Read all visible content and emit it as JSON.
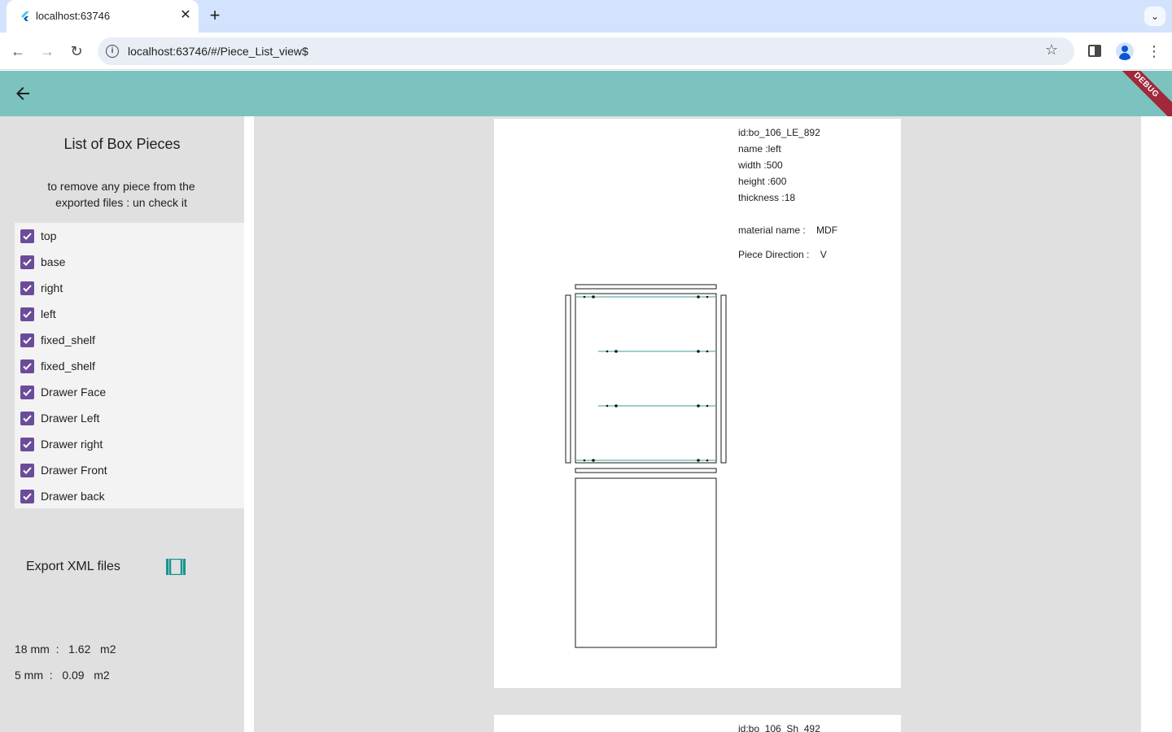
{
  "browser": {
    "tab_title": "localhost:63746",
    "url": "localhost:63746/#/Piece_List_view$"
  },
  "appbar": {
    "debug_label": "DEBUG"
  },
  "sidebar": {
    "title": "List of Box Pieces",
    "hint": "to remove any piece from the exported files : un check it",
    "pieces": [
      {
        "label": "top",
        "checked": true
      },
      {
        "label": "base",
        "checked": true
      },
      {
        "label": "right",
        "checked": true
      },
      {
        "label": "left",
        "checked": true
      },
      {
        "label": "fixed_shelf",
        "checked": true
      },
      {
        "label": "fixed_shelf",
        "checked": true
      },
      {
        "label": "Drawer Face",
        "checked": true
      },
      {
        "label": "Drawer Left",
        "checked": true
      },
      {
        "label": "Drawer right",
        "checked": true
      },
      {
        "label": "Drawer Front",
        "checked": true
      },
      {
        "label": "Drawer back",
        "checked": true
      }
    ],
    "export_label": "Export XML files",
    "areas": [
      "18 mm  :   1.62   m2",
      "5 mm  :   0.09   m2"
    ]
  },
  "cards": [
    {
      "id": "id:bo_106_LE_892",
      "name": "name :left",
      "width": "width :500",
      "height": "height :600",
      "thickness": "thickness :18",
      "material": "material name :    MDF",
      "direction": "Piece Direction :    V"
    },
    {
      "id": "id:bo_106_Sh_492"
    }
  ],
  "colors": {
    "appbar": "#7cc3c0",
    "checkbox": "#6b4c9a",
    "export_icon": "#17968f",
    "drawing_line": "#3a9e98"
  }
}
